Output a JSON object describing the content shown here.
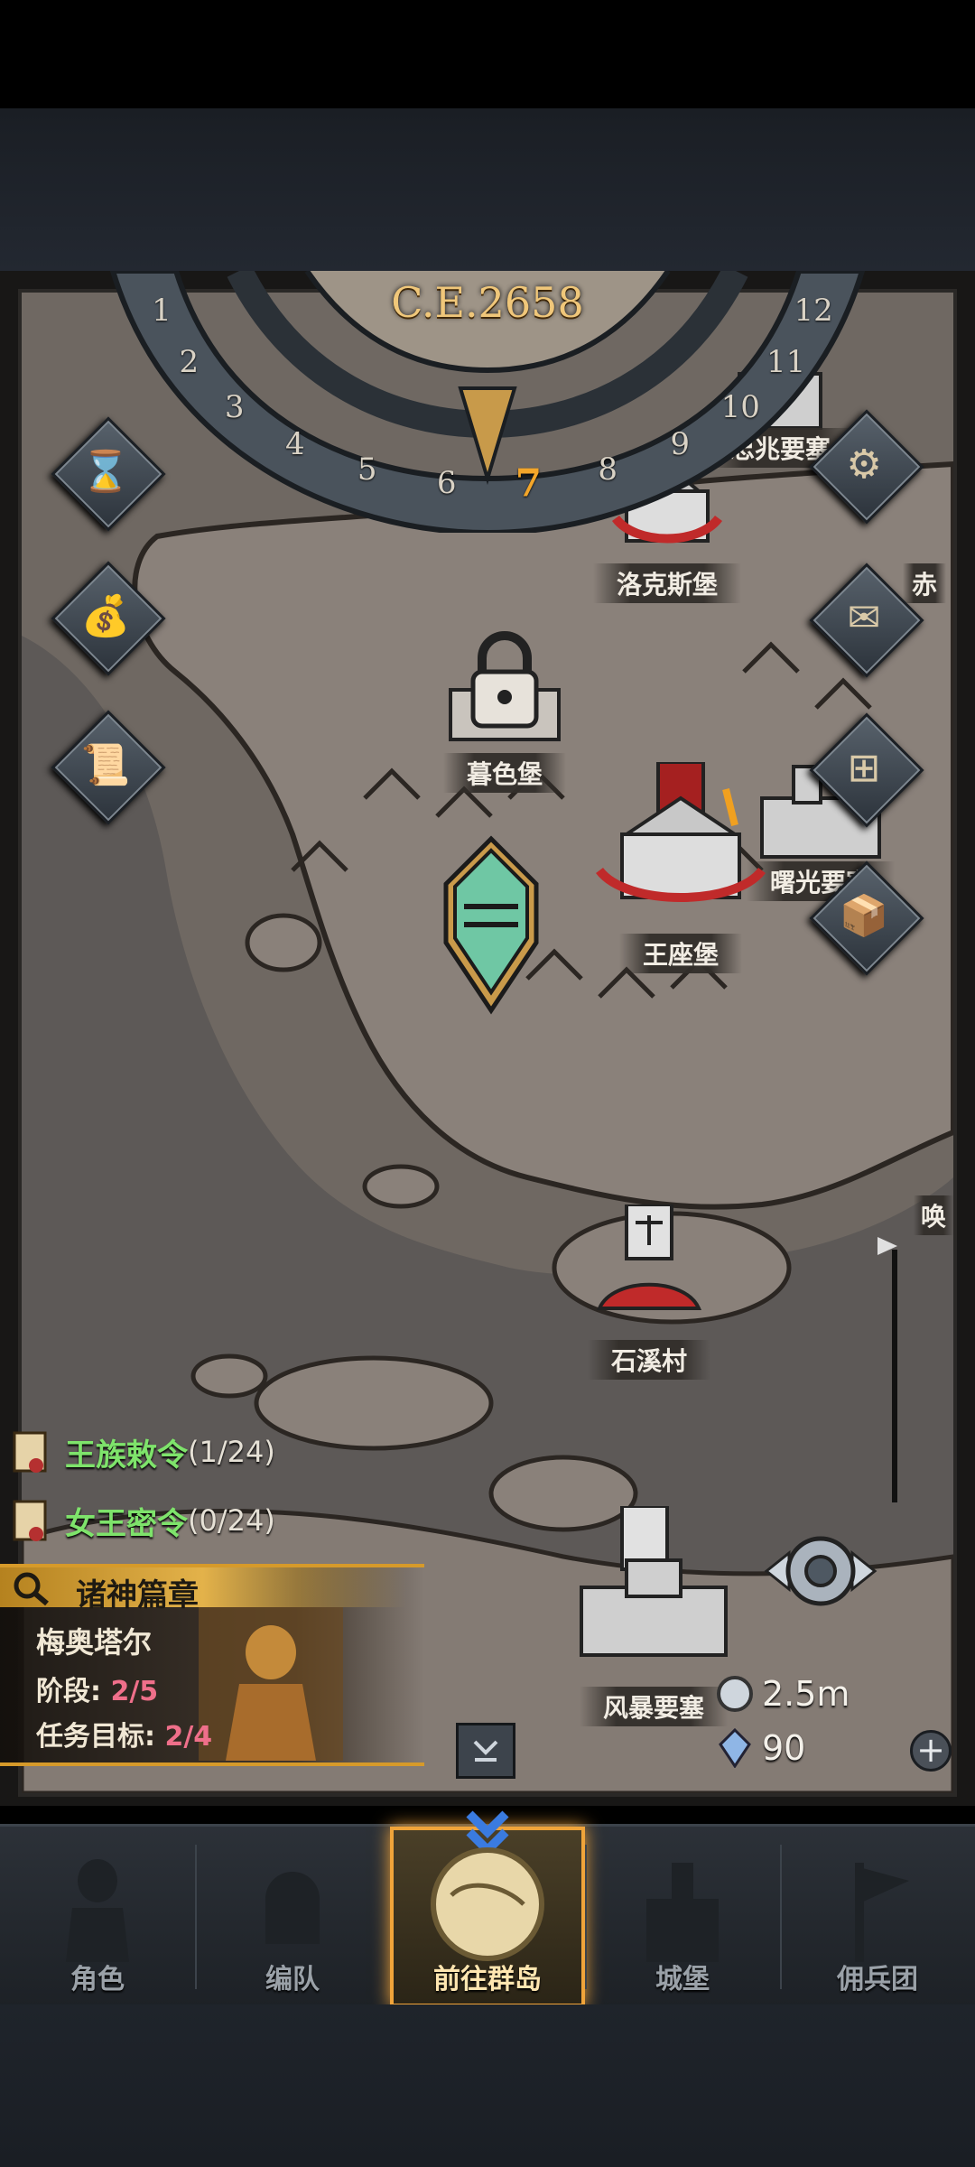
{
  "era": {
    "year": "C.E.2658",
    "numbers": [
      "1",
      "2",
      "3",
      "4",
      "5",
      "6",
      "7",
      "8",
      "9",
      "10",
      "11",
      "12"
    ],
    "active": "7"
  },
  "places": {
    "top_fortress": "忠兆要塞",
    "north_east": "赤",
    "loxburg": "洛克斯堡",
    "dusk": "暮色堡",
    "dawn": "曙光要塞",
    "throne": "王座堡",
    "stone": "石溪村",
    "storm": "风暴要塞",
    "east_edge": "唤"
  },
  "orders": [
    {
      "name": "王族敕令",
      "count": "(1/24)"
    },
    {
      "name": "女王密令",
      "count": "(0/24)"
    }
  ],
  "chapter": {
    "title": "诸神篇章",
    "boss": "梅奥塔尔",
    "stage_label": "阶段:",
    "stage_value": "2/5",
    "goal_label": "任务目标:",
    "goal_value": "2/4"
  },
  "resources": {
    "silver": "2.5m",
    "crystal": "90"
  },
  "side_icons": [
    "hourglass-icon",
    "bag-icon",
    "scroll-icon",
    "gear-icon",
    "mail-icon",
    "grid-icon",
    "supplies-icon"
  ],
  "nav": [
    {
      "label": "角色",
      "active": false
    },
    {
      "label": "编队",
      "active": false
    },
    {
      "label": "前往群岛",
      "active": true
    },
    {
      "label": "城堡",
      "active": false
    },
    {
      "label": "佣兵团",
      "active": false
    }
  ],
  "colors": {
    "accent": "#f0a43a",
    "quest_green": "#7ee36b",
    "progress_pink": "#ef6f8a"
  }
}
